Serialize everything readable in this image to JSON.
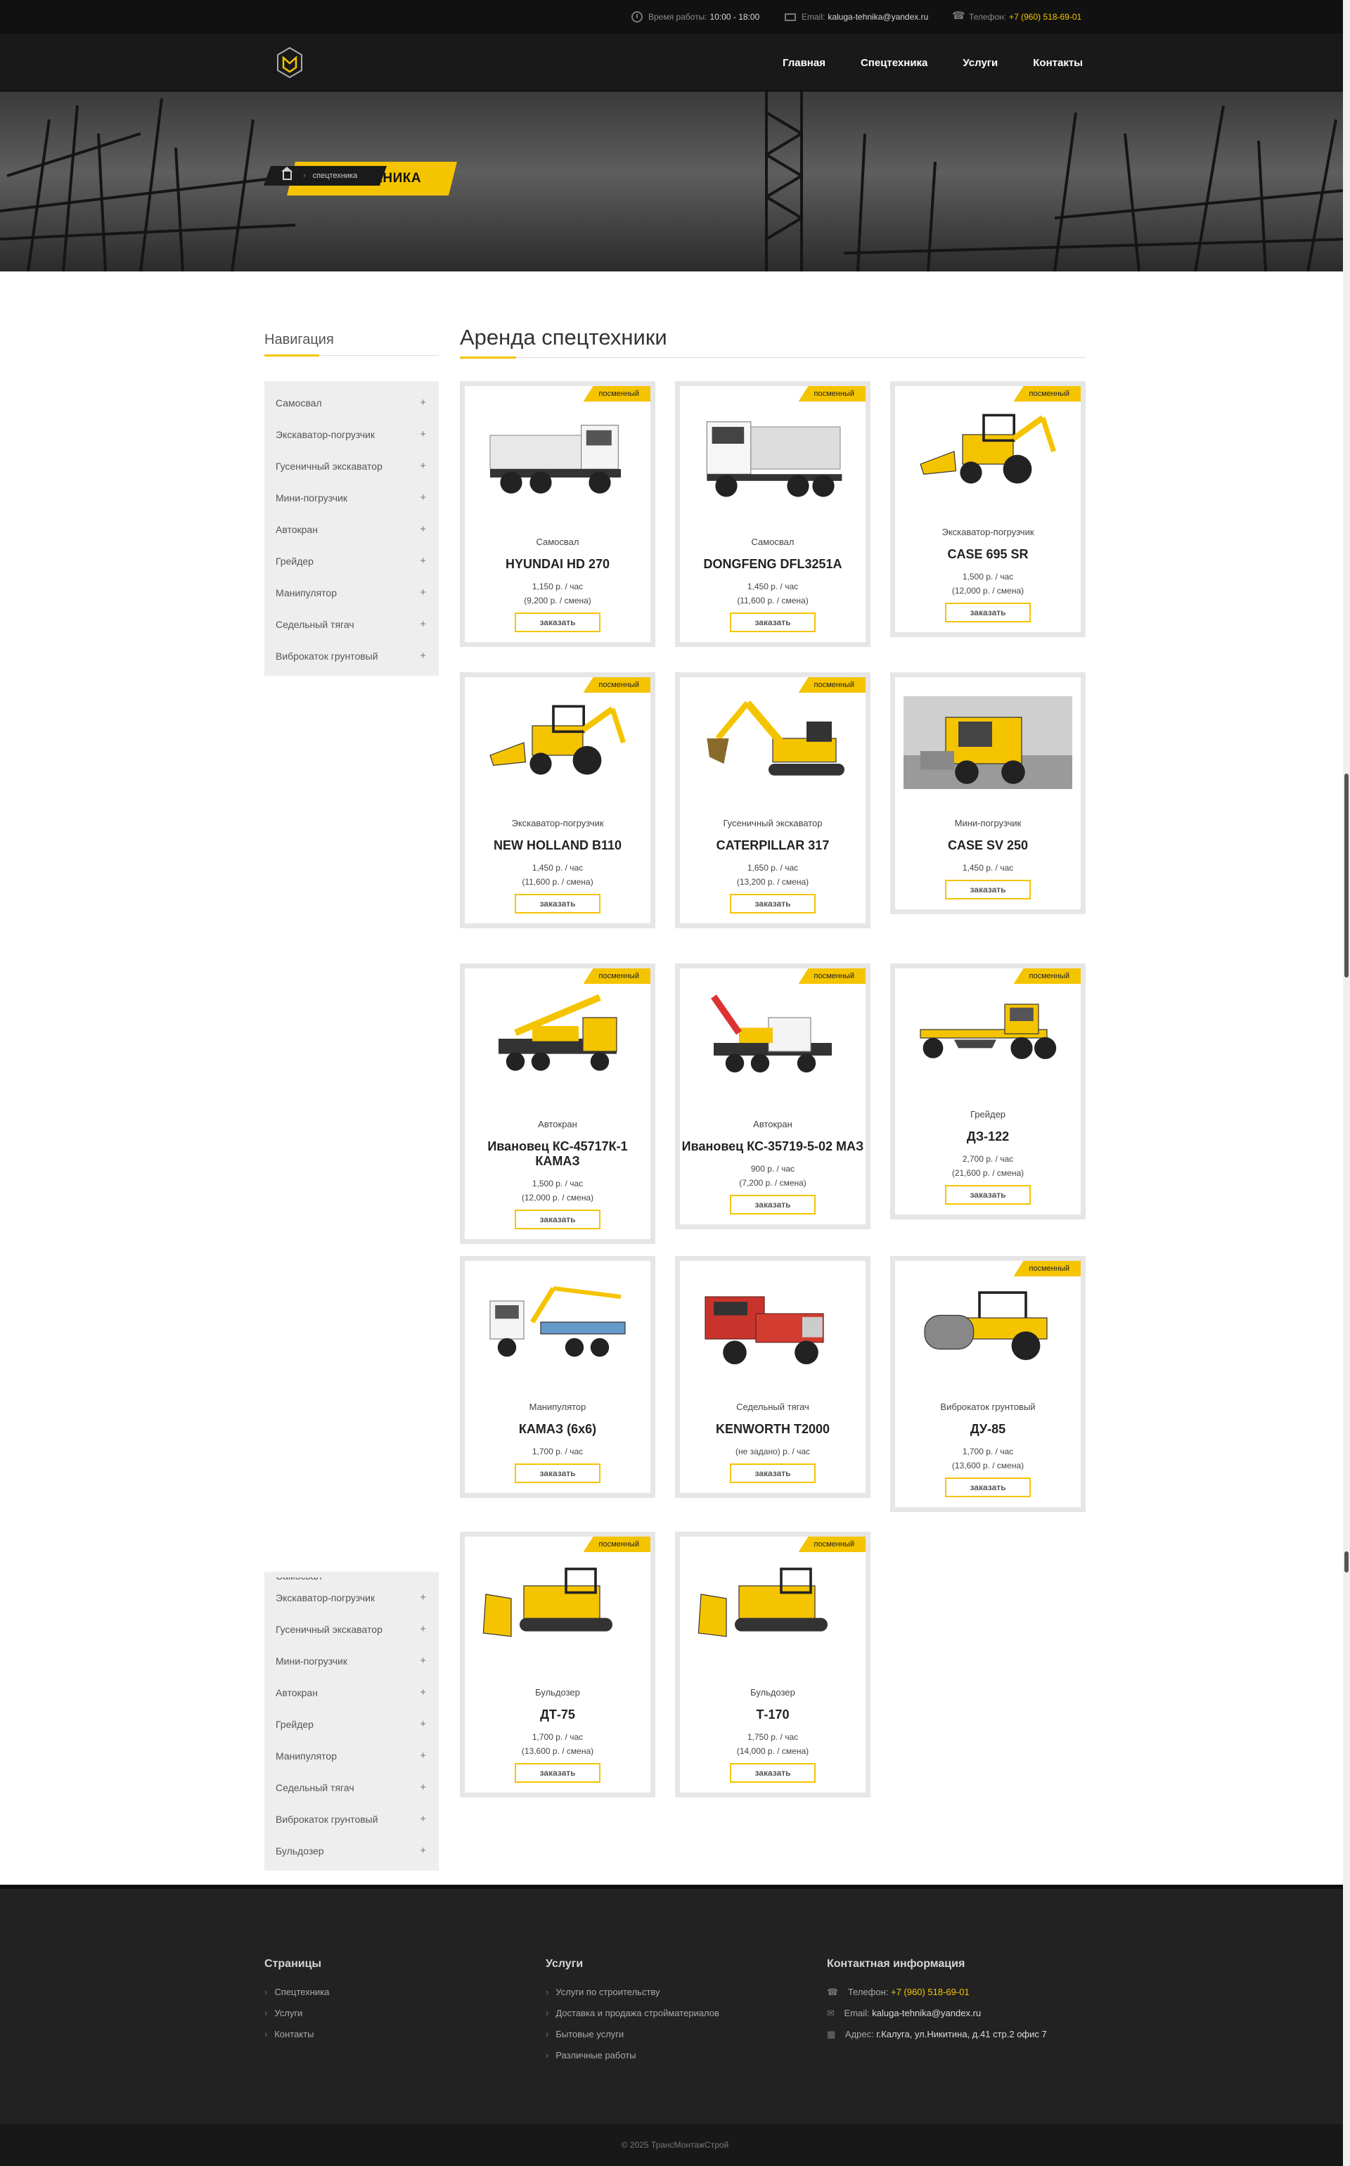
{
  "topbar": {
    "hours_label": "Время работы:",
    "hours_value": "10:00 - 18:00",
    "email_label": "Email:",
    "email_value": "kaluga-tehnika@yandex.ru",
    "phone_label": "Телефон:",
    "phone_value": "+7 (960) 518-69-01"
  },
  "nav": [
    "Главная",
    "Спецтехника",
    "Услуги",
    "Контакты"
  ],
  "hero": {
    "title": "СПЕЦТЕХНИКА",
    "breadcrumb_current": "спецтехника"
  },
  "sidebar": {
    "title": "Навигация",
    "items": [
      "Самосвал",
      "Экскаватор-погрузчик",
      "Гусеничный экскаватор",
      "Мини-погрузчик",
      "Автокран",
      "Грейдер",
      "Манипулятор",
      "Седельный тягач",
      "Виброкаток грунтовый"
    ],
    "items2_first_partial": "Самосвал",
    "items2": [
      "Экскаватор-погрузчик",
      "Гусеничный экскаватор",
      "Мини-погрузчик",
      "Автокран",
      "Грейдер",
      "Манипулятор",
      "Седельный тягач",
      "Виброкаток грунтовый",
      "Бульдозер"
    ],
    "plus": "+"
  },
  "main": {
    "title": "Аренда спецтехники"
  },
  "badge_text": "посменный",
  "order_label": "заказать",
  "products": [
    {
      "category": "Самосвал",
      "name": "HYUNDAI HD 270",
      "price": "1,150 р. / час",
      "shift": "(9,200 р. / смена)",
      "badge": true,
      "pic": "dump-white"
    },
    {
      "category": "Самосвал",
      "name": "DONGFENG DFL3251A",
      "price": "1,450 р. / час",
      "shift": "(11,600 р. / смена)",
      "badge": true,
      "pic": "dump-white2"
    },
    {
      "category": "Экскаватор-погрузчик",
      "name": "CASE 695 SR",
      "price": "1,500 р. / час",
      "shift": "(12,000 р. / смена)",
      "badge": true,
      "pic": "backhoe"
    },
    {
      "category": "Экскаватор-погрузчик",
      "name": "NEW HOLLAND B110",
      "price": "1,450 р. / час",
      "shift": "(11,600 р. / смена)",
      "badge": true,
      "pic": "backhoe"
    },
    {
      "category": "Гусеничный экскаватор",
      "name": "CATERPILLAR 317",
      "price": "1,650 р. / час",
      "shift": "(13,200 р. / смена)",
      "badge": true,
      "pic": "excavator"
    },
    {
      "category": "Мини-погрузчик",
      "name": "CASE SV 250",
      "price": "1,450 р. / час",
      "shift": "",
      "badge": false,
      "pic": "skid"
    },
    {
      "category": "Автокран",
      "name": "Ивановец КС-45717К-1 КАМАЗ",
      "price": "1,500 р. / час",
      "shift": "(12,000 р. / смена)",
      "badge": true,
      "pic": "crane"
    },
    {
      "category": "Автокран",
      "name": "Ивановец КС-35719-5-02 МАЗ",
      "price": "900 р. / час",
      "shift": "(7,200 р. / смена)",
      "badge": true,
      "pic": "crane2"
    },
    {
      "category": "Грейдер",
      "name": "ДЗ-122",
      "price": "2,700 р. / час",
      "shift": "(21,600 р. / смена)",
      "badge": true,
      "pic": "grader"
    },
    {
      "category": "Манипулятор",
      "name": "КАМАЗ (6x6)",
      "price": "1,700 р. / час",
      "shift": "",
      "badge": false,
      "pic": "manip"
    },
    {
      "category": "Седельный тягач",
      "name": "KENWORTH T2000",
      "price": "(не задано) р. / час",
      "shift": "",
      "badge": false,
      "pic": "tractor"
    },
    {
      "category": "Виброкаток грунтовый",
      "name": "ДУ-85",
      "price": "1,700 р. / час",
      "shift": "(13,600 р. / смена)",
      "badge": true,
      "pic": "roller"
    },
    {
      "category": "Бульдозер",
      "name": "ДТ-75",
      "price": "1,700 р. / час",
      "shift": "(13,600 р. / смена)",
      "badge": true,
      "pic": "dozer"
    },
    {
      "category": "Бульдозер",
      "name": "Т-170",
      "price": "1,750 р. / час",
      "shift": "(14,000 р. / смена)",
      "badge": true,
      "pic": "dozer"
    }
  ],
  "footer": {
    "pages_title": "Страницы",
    "pages": [
      "Спецтехника",
      "Услуги",
      "Контакты"
    ],
    "services_title": "Услуги",
    "services": [
      "Услуги по строительству",
      "Доставка и продажа стройматериалов",
      "Бытовые услуги",
      "Различные работы"
    ],
    "contact_title": "Контактная информация",
    "phone_label": "Телефон:",
    "phone_value": "+7 (960) 518-69-01",
    "email_label": "Email:",
    "email_value": "kaluga-tehnika@yandex.ru",
    "address_label": "Адрес:",
    "address_value": "г.Калуга, ул.Никитина, д.41 стр.2 офис 7",
    "copyright": "© 2025 ТрансМонтажСтрой"
  },
  "colors": {
    "accent": "#f5c400",
    "dark": "#191919",
    "footer": "#222222"
  }
}
